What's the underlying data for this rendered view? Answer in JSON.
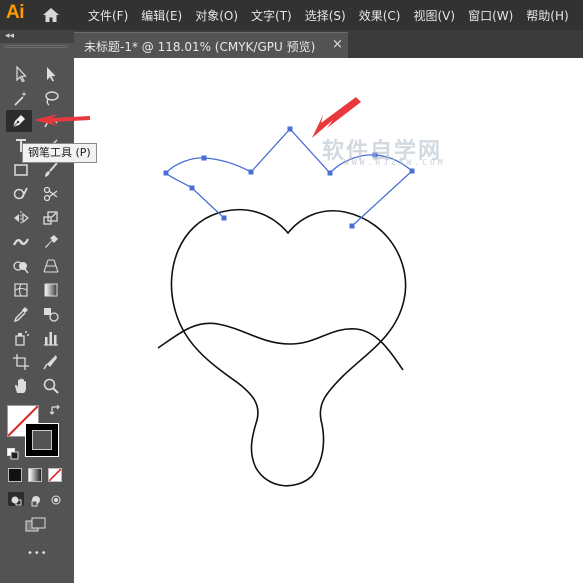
{
  "app": {
    "logo": "Ai"
  },
  "menu": {
    "items": [
      "文件(F)",
      "编辑(E)",
      "对象(O)",
      "文字(T)",
      "选择(S)",
      "效果(C)",
      "视图(V)",
      "窗口(W)",
      "帮助(H)"
    ]
  },
  "toolbar": {
    "collapse": "◂◂",
    "tools": [
      {
        "name": "selection-tool-icon"
      },
      {
        "name": "direct-selection-tool-icon"
      },
      {
        "name": "magic-wand-tool-icon"
      },
      {
        "name": "lasso-tool-icon"
      },
      {
        "name": "pen-tool-icon",
        "active": true
      },
      {
        "name": "curvature-tool-icon"
      },
      {
        "name": "type-tool-icon"
      },
      {
        "name": "line-segment-tool-icon"
      },
      {
        "name": "rectangle-tool-icon"
      },
      {
        "name": "paintbrush-tool-icon"
      },
      {
        "name": "shaper-tool-icon"
      },
      {
        "name": "scissors-tool-icon"
      },
      {
        "name": "reflect-tool-icon"
      },
      {
        "name": "scale-tool-icon"
      },
      {
        "name": "width-tool-icon"
      },
      {
        "name": "puppet-warp-tool-icon"
      },
      {
        "name": "shape-builder-tool-icon"
      },
      {
        "name": "perspective-grid-tool-icon"
      },
      {
        "name": "mesh-tool-icon"
      },
      {
        "name": "gradient-tool-icon"
      },
      {
        "name": "eyedropper-tool-icon"
      },
      {
        "name": "blend-tool-icon"
      },
      {
        "name": "symbol-sprayer-tool-icon"
      },
      {
        "name": "column-graph-tool-icon"
      },
      {
        "name": "artboard-tool-icon"
      },
      {
        "name": "slice-tool-icon"
      },
      {
        "name": "hand-tool-icon"
      },
      {
        "name": "zoom-tool-icon"
      }
    ],
    "fill_color": "#ffffff",
    "stroke_color": "#000000",
    "more": "•••"
  },
  "tooltip": {
    "text": "钢笔工具 (P)"
  },
  "document": {
    "tab_title": "未标题-1* @ 118.01% (CMYK/GPU 预览)",
    "close": "×"
  },
  "watermark": {
    "text": "软件自学网",
    "sub": "WWW.RJZXW.COM"
  },
  "colors": {
    "accent": "#ff9a00",
    "path_selection": "#4a6fd4",
    "arrow": "#e8383d"
  }
}
